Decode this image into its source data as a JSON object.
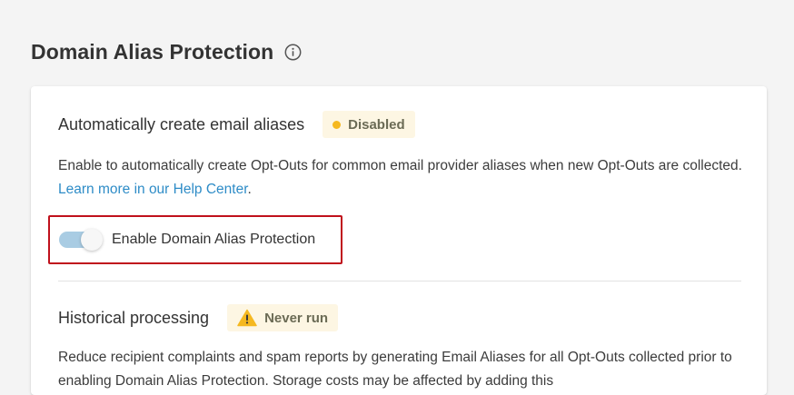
{
  "page": {
    "title": "Domain Alias Protection",
    "info_icon": "info-circle-icon"
  },
  "auto_create": {
    "heading": "Automatically create email aliases",
    "status_label": "Disabled",
    "status_color": "#f5b820",
    "description": "Enable to automatically create Opt-Outs for common email provider aliases when new Opt-Outs are collected. ",
    "link_text": "Learn more in our Help Center",
    "trailing": ".",
    "toggle_label": "Enable Domain Alias Protection",
    "toggle_on": true
  },
  "historical": {
    "heading": "Historical processing",
    "status_label": "Never run",
    "status_icon": "warning-triangle-icon",
    "description": "Reduce recipient complaints and spam reports by generating Email Aliases for all Opt-Outs collected prior to enabling Domain Alias Protection. Storage costs may be affected by adding this"
  },
  "colors": {
    "link": "#2e8cc7",
    "highlight_border": "#c0111c",
    "toggle_track": "#a9cce3",
    "badge_bg": "#fdf6e3"
  }
}
